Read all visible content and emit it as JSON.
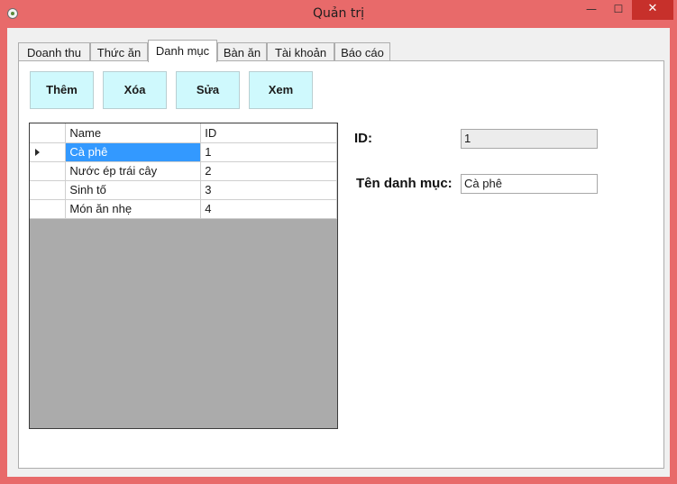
{
  "window": {
    "title": "Quản trị",
    "min_glyph": "—",
    "max_glyph": "☐",
    "close_glyph": "✕"
  },
  "tabs": [
    "Doanh thu",
    "Thức ăn",
    "Danh mục",
    "Bàn ăn",
    "Tài khoản",
    "Báo cáo"
  ],
  "active_tab": "Danh mục",
  "buttons": {
    "add": "Thêm",
    "delete": "Xóa",
    "edit": "Sửa",
    "view": "Xem"
  },
  "grid": {
    "columns": [
      "Name",
      "ID"
    ],
    "rows": [
      {
        "name": "Cà phê",
        "id": "1"
      },
      {
        "name": "Nước ép trái cây",
        "id": "2"
      },
      {
        "name": "Sinh tố",
        "id": "3"
      },
      {
        "name": "Món ăn nhẹ",
        "id": "4"
      }
    ],
    "selected_row": 0
  },
  "form": {
    "id_label": "ID:",
    "id_value": "1",
    "name_label": "Tên danh mục:",
    "name_value": "Cà phê"
  },
  "colors": {
    "titlebar": "#e86a6a",
    "button_bg": "#cff9fd",
    "selection": "#3399ff",
    "grid_bg": "#ababab",
    "close_button": "#c7302b"
  },
  "icons": {
    "app": "app-icon",
    "row_indicator": "current-row-arrow-icon"
  }
}
